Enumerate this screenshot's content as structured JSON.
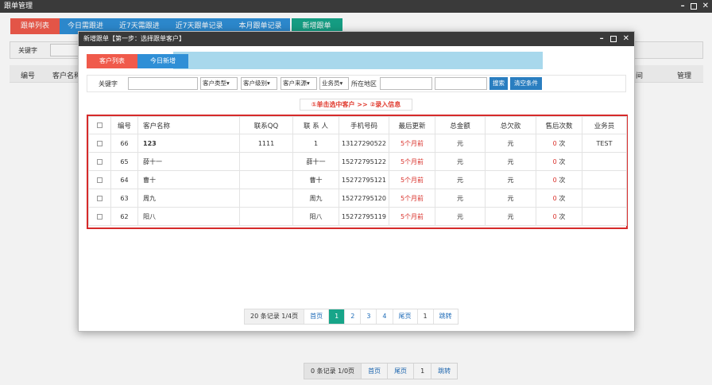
{
  "outer": {
    "title": "跟单管理",
    "tabs": [
      "跟单列表",
      "今日需跟进",
      "近7天需跟进",
      "近7天跟单记录",
      "本月跟单记录",
      "新增跟单"
    ],
    "search_label": "关键字",
    "headers": [
      "编号",
      "客户名称",
      "间",
      "管理"
    ],
    "pager": {
      "info": "0 条记录 1/0页",
      "first": "首页",
      "last": "尾页",
      "page": "1",
      "jump": "跳转"
    }
  },
  "modal": {
    "title": "新增跟单【第一步：选择跟单客户】",
    "tabs": [
      "客户列表",
      "今日新增"
    ],
    "search": {
      "keyword_label": "关键字",
      "selects": [
        "客户类型",
        "客户级别",
        "客户来源",
        "业务员"
      ],
      "region_label": "所在地区",
      "search_btn": "搜索",
      "clear_btn": "清空条件"
    },
    "hint": "①单击选中客户 >> ②录入信息",
    "table": {
      "headers": [
        "",
        "编号",
        "客户名称",
        "联系QQ",
        "联 系 人",
        "手机号码",
        "最后更新",
        "总金额",
        "总欠款",
        "售后次数",
        "业务员"
      ],
      "rows": [
        {
          "id": "66",
          "name": "123",
          "qq": "1111",
          "contact": "1",
          "phone": "13127290522",
          "updated": "5个月前",
          "amount": "元",
          "debt": "元",
          "after": "0",
          "after_unit": "次",
          "sales": "TEST"
        },
        {
          "id": "65",
          "name": "薛十一",
          "qq": "",
          "contact": "薛十一",
          "phone": "15272795122",
          "updated": "5个月前",
          "amount": "元",
          "debt": "元",
          "after": "0",
          "after_unit": "次",
          "sales": ""
        },
        {
          "id": "64",
          "name": "曹十",
          "qq": "",
          "contact": "曹十",
          "phone": "15272795121",
          "updated": "5个月前",
          "amount": "元",
          "debt": "元",
          "after": "0",
          "after_unit": "次",
          "sales": ""
        },
        {
          "id": "63",
          "name": "周九",
          "qq": "",
          "contact": "周九",
          "phone": "15272795120",
          "updated": "5个月前",
          "amount": "元",
          "debt": "元",
          "after": "0",
          "after_unit": "次",
          "sales": ""
        },
        {
          "id": "62",
          "name": "阳八",
          "qq": "",
          "contact": "阳八",
          "phone": "15272795119",
          "updated": "5个月前",
          "amount": "元",
          "debt": "元",
          "after": "0",
          "after_unit": "次",
          "sales": ""
        }
      ]
    },
    "pager": {
      "info": "20 条记录 1/4页",
      "first": "首页",
      "pages": [
        "1",
        "2",
        "3",
        "4"
      ],
      "last": "尾页",
      "page": "1",
      "jump": "跳转"
    }
  },
  "icons": {
    "minimize": "minimize-icon",
    "maximize": "maximize-icon",
    "close": "close-icon"
  },
  "colors": {
    "red_tab": "#f05a4b",
    "blue_tab": "#2f8fd6",
    "green": "#17a589",
    "highlight_border": "#d62a2a"
  }
}
